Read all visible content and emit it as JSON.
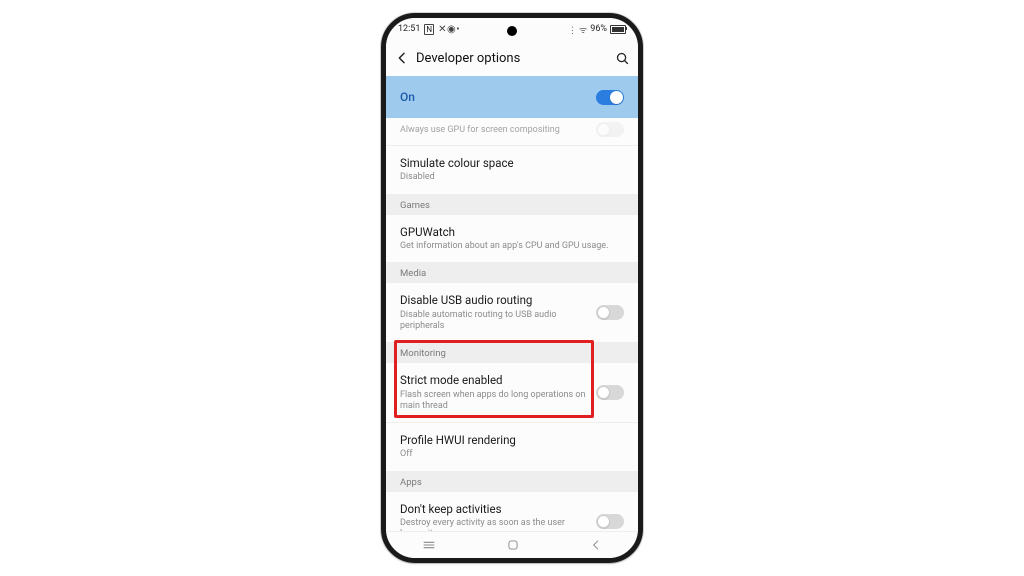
{
  "status": {
    "time": "12:51",
    "nt_indicator": "N",
    "battery_text": "96%"
  },
  "appbar": {
    "title": "Developer options"
  },
  "master_toggle": {
    "label": "On",
    "value": true
  },
  "partial_top_row": {
    "subtitle": "Always use GPU for screen compositing"
  },
  "rows": {
    "simulate_colour": {
      "title": "Simulate colour space",
      "subtitle": "Disabled"
    },
    "gpuwatch": {
      "title": "GPUWatch",
      "subtitle": "Get information about an app's CPU and GPU usage."
    },
    "disable_usb_audio": {
      "title": "Disable USB audio routing",
      "subtitle": "Disable automatic routing to USB audio peripherals",
      "value": false
    },
    "strict_mode": {
      "title": "Strict mode enabled",
      "subtitle": "Flash screen when apps do long operations on main thread",
      "value": false
    },
    "profile_hwui": {
      "title": "Profile HWUI rendering",
      "subtitle": "Off"
    },
    "dont_keep_activities": {
      "title": "Don't keep activities",
      "subtitle": "Destroy every activity as soon as the user leaves it",
      "value": false
    }
  },
  "sections": {
    "games": "Games",
    "media": "Media",
    "monitoring": "Monitoring",
    "apps": "Apps"
  }
}
